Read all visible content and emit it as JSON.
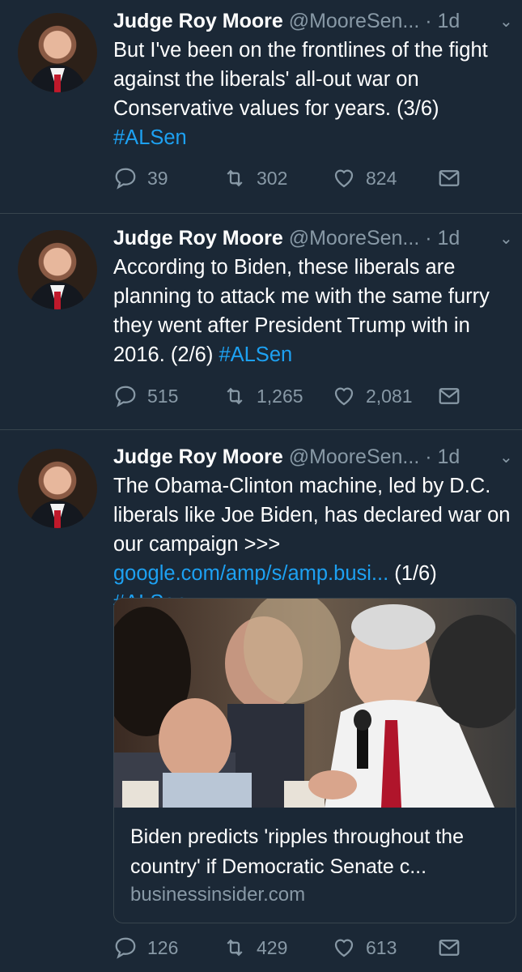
{
  "tweets": [
    {
      "name": "Judge Roy Moore",
      "handle": "@MooreSen...",
      "time": "· 1d",
      "text_plain": "But I've been on the frontlines of the fight against the liberals' all-out war on Conservative values for years. (3/6)",
      "hashtag": "#ALSen",
      "replies": "39",
      "retweets": "302",
      "likes": "824"
    },
    {
      "name": "Judge Roy Moore",
      "handle": "@MooreSen...",
      "time": "· 1d",
      "text_plain": "According to Biden, these liberals are planning to attack me with the same furry they went after President Trump with in 2016. (2/6)",
      "hashtag": "#ALSen",
      "replies": "515",
      "retweets": "1,265",
      "likes": "2,081"
    },
    {
      "name": "Judge Roy Moore",
      "handle": "@MooreSen...",
      "time": "· 1d",
      "text_plain": "The Obama-Clinton machine, led by D.C. liberals like Joe Biden, has declared war on our campaign >>>",
      "link": "google.com/amp/s/amp.busi...",
      "text_after_link": "(1/6)",
      "hashtag": "#ALSen",
      "card": {
        "title": "Biden predicts 'ripples throughout the country' if Democratic Senate c...",
        "domain": "businessinsider.com"
      },
      "replies": "126",
      "retweets": "429",
      "likes": "613"
    }
  ],
  "colors": {
    "background": "#1b2836",
    "text": "#ffffff",
    "secondary": "#8899a6",
    "link": "#1da1f2",
    "divider": "#38444d"
  },
  "icons": [
    "reply-icon",
    "retweet-icon",
    "like-icon",
    "message-icon",
    "chevron-down-icon"
  ]
}
